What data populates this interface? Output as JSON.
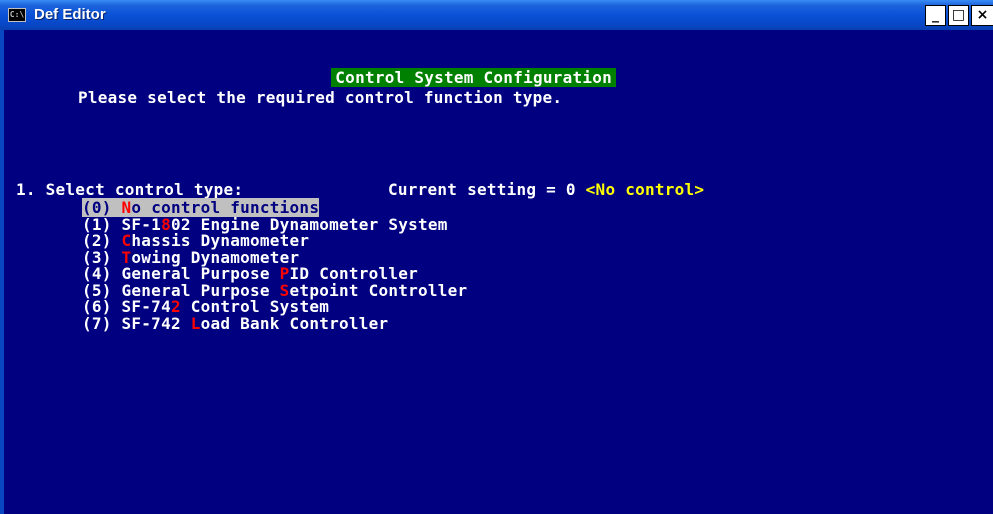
{
  "window": {
    "icon_text": "C:\\",
    "title": "Def Editor",
    "minimize_label": "_",
    "maximize_label": "□",
    "close_label": "×"
  },
  "console": {
    "header": "Control System Configuration",
    "prompt": "Please select the required control function type.",
    "question_label": "1. Select control type:",
    "current_setting_label": "Current setting = 0",
    "current_setting_value": "<No control>",
    "options": [
      {
        "num": "(0) ",
        "pre": "",
        "hot": "N",
        "post": "o control functions",
        "selected": true
      },
      {
        "num": "(1) ",
        "pre": "SF-1",
        "hot": "8",
        "post": "02 Engine Dynamometer System",
        "selected": false
      },
      {
        "num": "(2) ",
        "pre": "",
        "hot": "C",
        "post": "hassis Dynamometer",
        "selected": false
      },
      {
        "num": "(3) ",
        "pre": "",
        "hot": "T",
        "post": "owing Dynamometer",
        "selected": false
      },
      {
        "num": "(4) ",
        "pre": "General Purpose ",
        "hot": "P",
        "post": "ID Controller",
        "selected": false
      },
      {
        "num": "(5) ",
        "pre": "General Purpose ",
        "hot": "S",
        "post": "etpoint Controller",
        "selected": false
      },
      {
        "num": "(6) ",
        "pre": "SF-74",
        "hot": "2",
        "post": " Control System",
        "selected": false
      },
      {
        "num": "(7) ",
        "pre": "SF-742 ",
        "hot": "L",
        "post": "oad Bank Controller",
        "selected": false
      }
    ]
  },
  "colors": {
    "background": "#000080",
    "header_bg": "#008000",
    "hotkey": "#ff0000",
    "setting_value": "#ffff00",
    "selection_bg": "#c0c0c0"
  }
}
